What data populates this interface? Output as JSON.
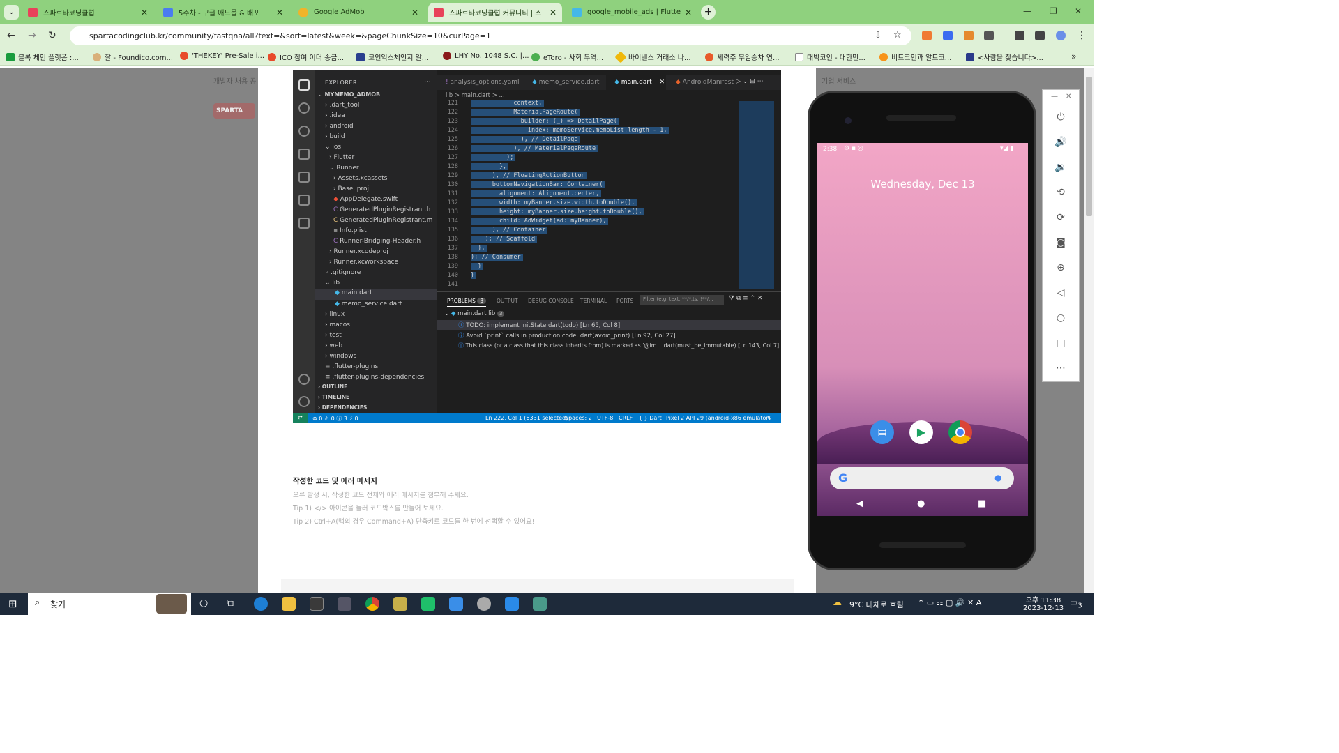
{
  "browser": {
    "tabs": [
      {
        "label": "스파르타코딩클럽",
        "active": false
      },
      {
        "label": "5주차 - 구글 애드몹 & 배포",
        "active": false
      },
      {
        "label": "Google AdMob",
        "active": false
      },
      {
        "label": "스파르타코딩클럽 커뮤니티 | 스",
        "active": true
      },
      {
        "label": "google_mobile_ads | Flutter Pa",
        "active": false
      }
    ],
    "url": "spartacodingclub.kr/community/fastqna/all?text=&sort=latest&week=&pageChunkSize=10&curPage=1",
    "bookmarks": [
      "블록 체인 플랫폼 :...",
      "잘 - Foundico.com...",
      "'THEKEY' Pre-Sale i...",
      "ICO 참여 이더 송금...",
      "코인익스체인지 알...",
      "LHY No. 1048 S.C. |...",
      "eToro - 사회 무역...",
      "바이낸스 거래소 나...",
      "세력주 무임승차 연...",
      "대박코인 - 대한민...",
      "비트코인과 알트코...",
      "<사람을 찾습니다>..."
    ]
  },
  "site": {
    "left_text": "개발자 채용 공",
    "right_text": "기업 서비스",
    "logo": "SPARTA"
  },
  "vscode": {
    "explorer_title": "EXPLORER",
    "project": "MYMEMO_ADMOB",
    "tree": [
      ".dart_tool",
      ".idea",
      "android",
      "build",
      "ios",
      "Flutter",
      "Runner",
      "Assets.xcassets",
      "Base.lproj",
      "AppDelegate.swift",
      "GeneratedPluginRegistrant.h",
      "GeneratedPluginRegistrant.m",
      "Info.plist",
      "Runner-Bridging-Header.h",
      "Runner.xcodeproj",
      "Runner.xcworkspace",
      ".gitignore",
      "lib",
      "main.dart",
      "memo_service.dart",
      "linux",
      "macos",
      "test",
      "web",
      "windows",
      ".flutter-plugins",
      ".flutter-plugins-dependencies"
    ],
    "sections": [
      "OUTLINE",
      "TIMELINE",
      "DEPENDENCIES"
    ],
    "editor_tabs": [
      "analysis_options.yaml",
      "memo_service.dart",
      "main.dart",
      "AndroidManifest.xml"
    ],
    "breadcrumb": "lib  >  main.dart  > ...",
    "line_numbers": [
      "121",
      "122",
      "123",
      "124",
      "125",
      "126",
      "127",
      "128",
      "129",
      "130",
      "131",
      "132",
      "133",
      "134",
      "135",
      "136",
      "137",
      "138",
      "139",
      "140",
      "141"
    ],
    "code_lines": [
      "            context,",
      "            MaterialPageRoute(",
      "              builder: (_) => DetailPage(",
      "                index: memoService.memoList.length - 1,",
      "              ), // DetailPage",
      "            ), // MaterialPageRoute",
      "          );",
      "        },",
      "      ), // FloatingActionButton",
      "      bottomNavigationBar: Container(",
      "        alignment: Alignment.center,",
      "        width: myBanner.size.width.toDouble(),",
      "        height: myBanner.size.height.toDouble(),",
      "        child: AdWidget(ad: myBanner),",
      "      ), // Container",
      "    ); // Scaffold",
      "  },",
      "); // Consumer",
      "  }",
      "}",
      ""
    ],
    "panel_tabs": [
      "PROBLEMS",
      "OUTPUT",
      "DEBUG CONSOLE",
      "TERMINAL",
      "PORTS"
    ],
    "problems_count": "3",
    "filter_placeholder": "Filter (e.g. text, **/*.ts, !**/...",
    "problem_file": "main.dart  lib",
    "problems": [
      "TODO: implement initState  dart(todo)  [Ln 65, Col 8]",
      "Avoid `print` calls in production code.  dart(avoid_print)  [Ln 92, Col 27]",
      "This class (or a class that this class inherits from) is marked as '@im...   dart(must_be_immutable)  [Ln 143, Col 7]"
    ],
    "status": {
      "left": "⊗ 0 ⚠ 0 ⓘ 3    ⚡ 0",
      "position": "Ln 222, Col 1 (6331 selected)",
      "spaces": "Spaces: 2",
      "encoding": "UTF-8",
      "eol": "CRLF",
      "lang": "{ }  Dart",
      "device": "Pixel 2 API 29 (android-x86 emulator)"
    }
  },
  "post": {
    "heading": "작성한 코드 및 에러 메세지",
    "lines": [
      "오류 발생 시, 작성한 코드 전체와 에러 메시지를 첨부해 주세요.",
      "Tip 1) </> 아이콘을 눌러 코드박스를 만들어 보세요.",
      "Tip 2) Ctrl+A(맥의 경우 Command+A) 단축키로 코드를 한 번에 선택할 수 있어요!"
    ]
  },
  "phone": {
    "time": "2:38",
    "date": "Wednesday, Dec 13"
  },
  "taskbar": {
    "search": "찾기",
    "weather": "9°C  대체로 흐림",
    "time": "오후 11:38",
    "date": "2023-12-13",
    "notif": "3"
  }
}
